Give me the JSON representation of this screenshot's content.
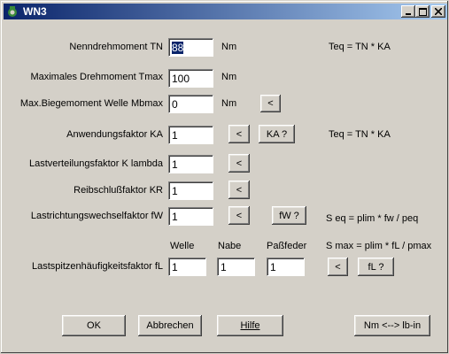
{
  "window": {
    "title": "WN3"
  },
  "title_buttons": {
    "minimize": "_",
    "maximize": "□",
    "close": "×"
  },
  "rows": {
    "tn": {
      "label": "Nenndrehmoment TN",
      "value": "88",
      "unit": "Nm",
      "note": "Teq = TN * KA"
    },
    "tmax": {
      "label": "Maximales Drehmoment Tmax",
      "value": "100",
      "unit": "Nm"
    },
    "mb": {
      "label": "Max.Biegemoment Welle Mbmax",
      "value": "0",
      "unit": "Nm",
      "arrow": "<"
    },
    "ka": {
      "label": "Anwendungsfaktor KA",
      "value": "1",
      "arrow": "<",
      "help": "KA ?",
      "note": "Teq = TN * KA"
    },
    "kl": {
      "label": "Lastverteilungsfaktor K lambda",
      "value": "1",
      "arrow": "<"
    },
    "kr": {
      "label": "Reibschlußfaktor KR",
      "value": "1",
      "arrow": "<"
    },
    "fw": {
      "label": "Lastrichtungswechselfaktor fW",
      "value": "1",
      "arrow": "<",
      "help": "fW ?",
      "note": "S eq = plim * fw / peq"
    },
    "fl": {
      "label": "Lastspitzenhäufigkeitsfaktor fL",
      "arrow": "<",
      "help": "fL ?",
      "note": "S max = plim * fL / pmax",
      "col_welle": "Welle",
      "col_nabe": "Nabe",
      "col_passfeder": "Paßfeder",
      "v_welle": "1",
      "v_nabe": "1",
      "v_passfeder": "1"
    }
  },
  "footer": {
    "ok": "OK",
    "cancel": "Abbrechen",
    "help": "Hilfe",
    "convert": "Nm <--> lb-in"
  }
}
